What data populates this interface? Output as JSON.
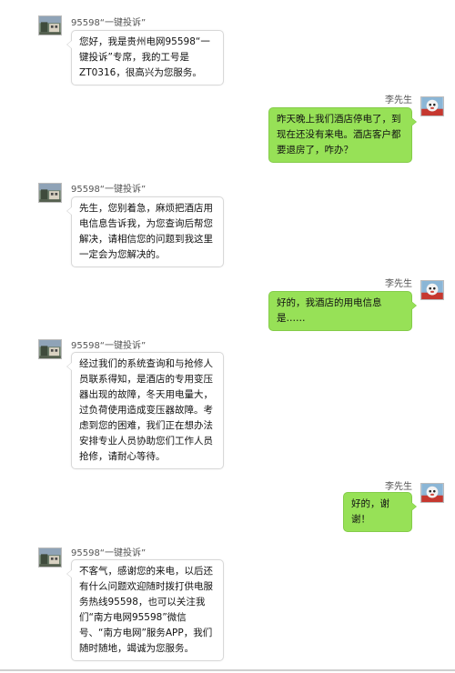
{
  "agent": {
    "name": "95598“一键投诉”",
    "avatar_icon": "agent-building-avatar"
  },
  "customer": {
    "name": "李先生",
    "avatar_icon": "cartoon-mascot-avatar"
  },
  "colors": {
    "outgoing_bubble": "#97e157",
    "incoming_bubble": "#ffffff",
    "background": "#ffffff"
  },
  "messages": [
    {
      "from": "agent",
      "name": "95598“一键投诉”",
      "text": "您好，我是贵州电网95598“一键投诉”专席，我的工号是ZT0316，很高兴为您服务。"
    },
    {
      "from": "customer",
      "name": "李先生",
      "text": "昨天晚上我们酒店停电了，到现在还没有来电。酒店客户都要退房了，咋办？"
    },
    {
      "from": "agent",
      "name": "95598“一键投诉”",
      "text": "先生，您别着急，麻烦把酒店用电信息告诉我，为您查询后帮您解决，请相信您的问题到我这里一定会为您解决的。"
    },
    {
      "from": "customer",
      "name": "李先生",
      "text": "好的，我酒店的用电信息是……"
    },
    {
      "from": "agent",
      "name": "95598“一键投诉”",
      "text": "经过我们的系统查询和与抢修人员联系得知，是酒店的专用变压器出现的故障，冬天用电量大，过负荷使用造成变压器故障。考虑到您的困难，我们正在想办法安排专业人员协助您们工作人员抢修，请耐心等待。"
    },
    {
      "from": "customer",
      "name": "李先生",
      "text": "好的，谢谢！"
    },
    {
      "from": "agent",
      "name": "95598“一键投诉”",
      "text": "不客气，感谢您的来电，以后还有什么问题欢迎随时拨打供电服务热线95598，也可以关注我们“南方电网95598”微信号、“南方电网”服务APP，我们随时随地，竭诚为您服务。"
    }
  ]
}
